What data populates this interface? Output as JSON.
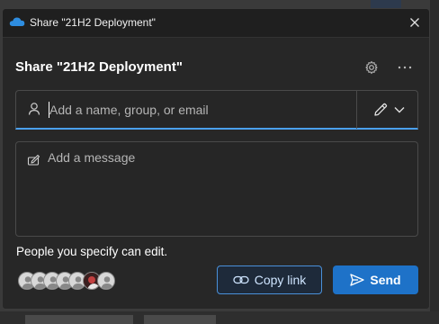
{
  "window": {
    "title": "Share \"21H2 Deployment\""
  },
  "dialog": {
    "heading": "Share \"21H2 Deployment\""
  },
  "recipients": {
    "placeholder": "Add a name, group, or email",
    "value": ""
  },
  "message": {
    "placeholder": "Add a message",
    "value": ""
  },
  "permission_text": "People you specify can edit.",
  "avatars": [
    {
      "kind": "generic"
    },
    {
      "kind": "generic"
    },
    {
      "kind": "generic"
    },
    {
      "kind": "generic"
    },
    {
      "kind": "generic"
    },
    {
      "kind": "photo"
    },
    {
      "kind": "generic"
    }
  ],
  "actions": {
    "copy_link_label": "Copy link",
    "send_label": "Send"
  },
  "icons": {
    "app": "onedrive-cloud-icon",
    "close": "close-icon",
    "settings": "gear-icon",
    "more": "more-icon",
    "person": "person-icon",
    "pencil": "pencil-icon",
    "chevron": "chevron-down-icon",
    "message": "compose-icon",
    "link": "link-icon",
    "send": "send-icon"
  },
  "colors": {
    "accent": "#1e72c8",
    "focus_underline": "#4aa0f0",
    "copy_link_border": "#4a90d9",
    "background": "#272727",
    "titlebar": "#1f1f1f"
  }
}
